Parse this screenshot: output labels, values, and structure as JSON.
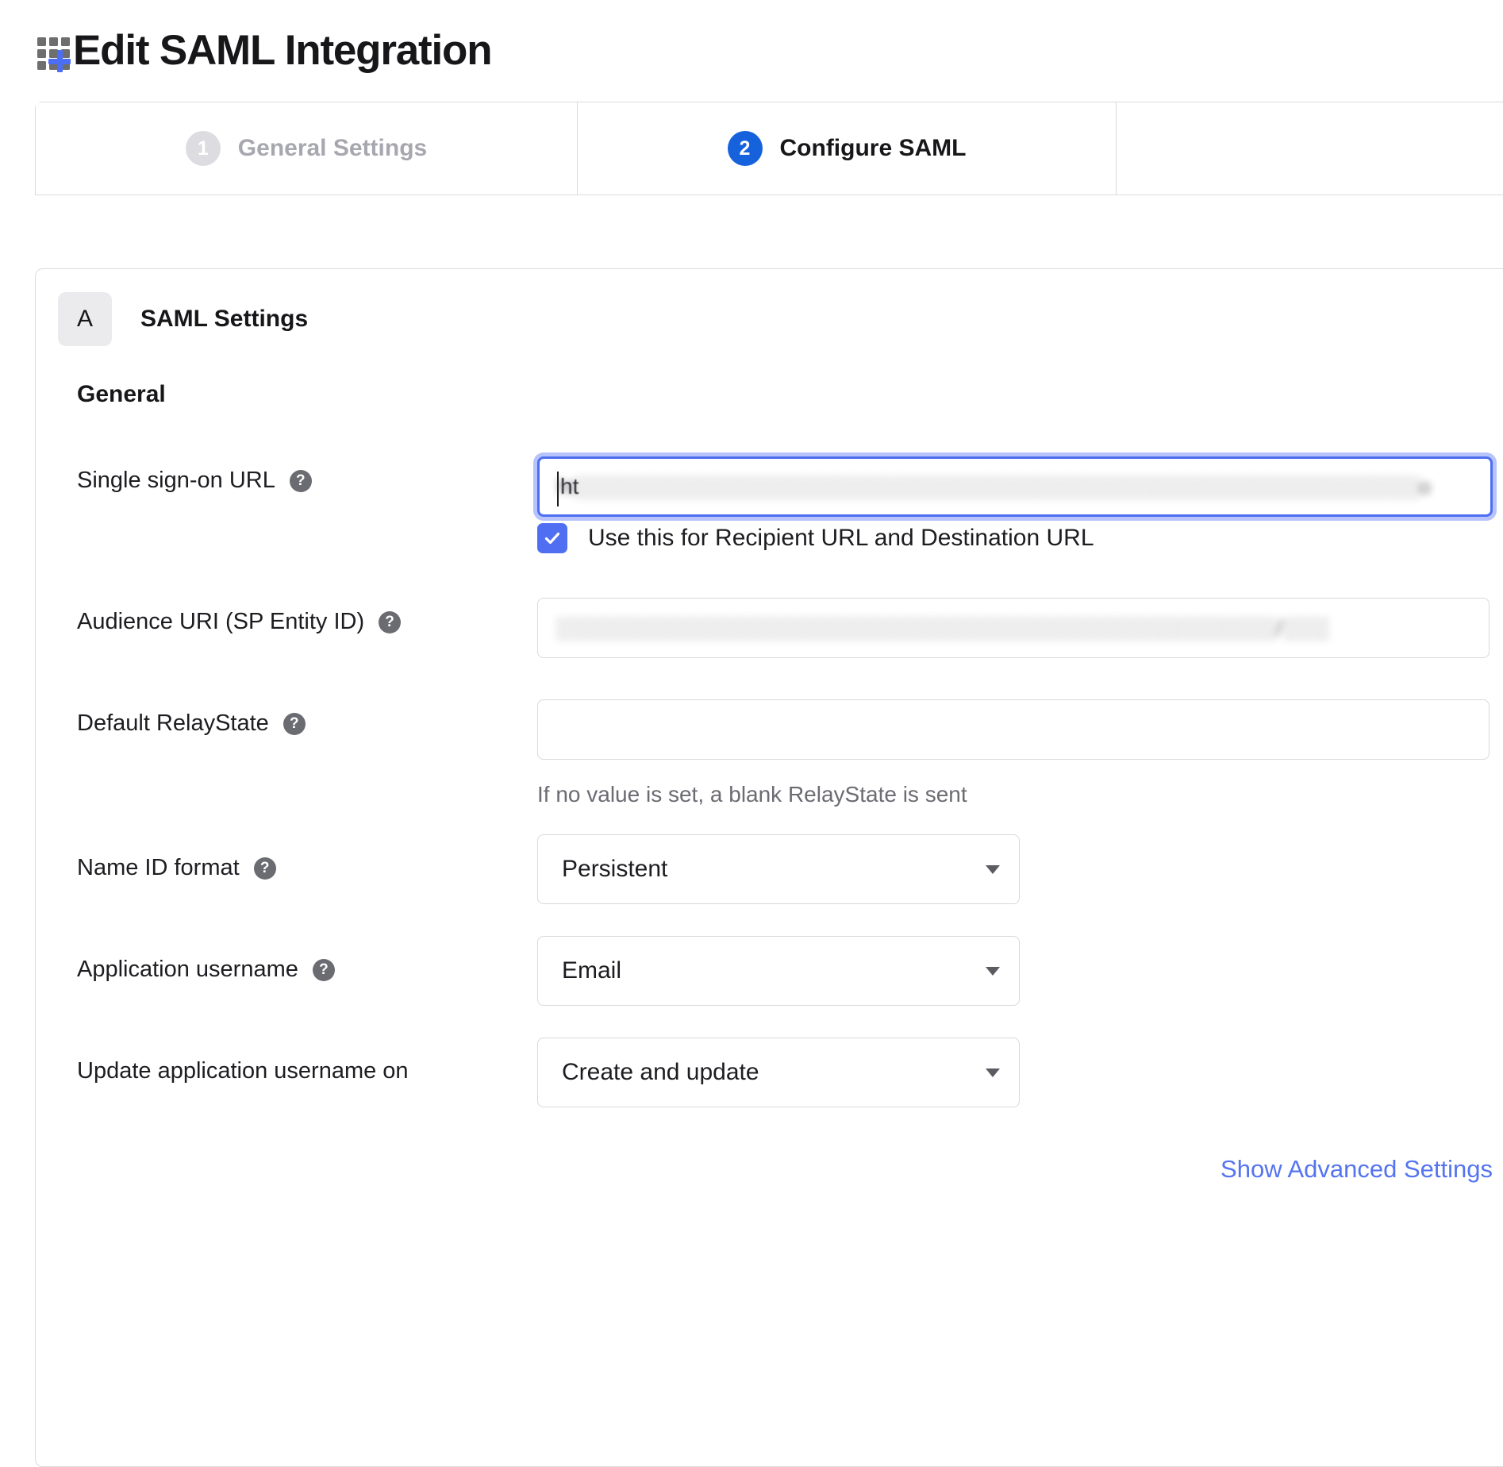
{
  "header": {
    "title": "Edit SAML Integration",
    "icon": "app-grid-plus-icon"
  },
  "tabs": [
    {
      "number": "1",
      "label": "General Settings",
      "active": false
    },
    {
      "number": "2",
      "label": "Configure SAML",
      "active": true
    },
    {
      "number": "",
      "label": "",
      "active": false
    }
  ],
  "section": {
    "letter": "A",
    "title": "SAML Settings",
    "group_title": "General"
  },
  "fields": {
    "sso_url": {
      "label": "Single sign-on URL",
      "help": "?",
      "value": "ht░░░░░░░░░░░░░░░░░░░░░░░░░░░░░░░░░░░░░░░░░░░░░░░░░░░░░░░o",
      "value_redacted": true,
      "focused": true,
      "lead_text": "ht"
    },
    "sso_checkbox": {
      "checked": true,
      "label": "Use this for Recipient URL and Destination URL"
    },
    "audience_uri": {
      "label": "Audience URI (SP Entity ID)",
      "help": "?",
      "value": "░░░░░░░░░░░░░░░░░░░░░░░░░░░░░░░░░░░░░░░░░░░░░░░/░░░",
      "value_redacted": true,
      "focused": false
    },
    "default_relay_state": {
      "label": "Default RelayState",
      "help": "?",
      "value": "",
      "placeholder": "",
      "helper_text": "If no value is set, a blank RelayState is sent"
    },
    "name_id_format": {
      "label": "Name ID format",
      "help": "?",
      "value": "Persistent"
    },
    "application_username": {
      "label": "Application username",
      "help": "?",
      "value": "Email"
    },
    "update_application_username_on": {
      "label": "Update application username on",
      "value": "Create and update"
    }
  },
  "advanced_link": {
    "label": "Show Advanced Settings"
  },
  "colors": {
    "accent_blue": "#1662dd",
    "link_blue": "#5574ef",
    "focus_blue": "#4d6ef0",
    "checkbox_blue": "#4f6ef2",
    "border_gray": "#dcdce0",
    "muted_text": "#6b6b72",
    "inactive_tab_text": "#a7a7b0"
  }
}
